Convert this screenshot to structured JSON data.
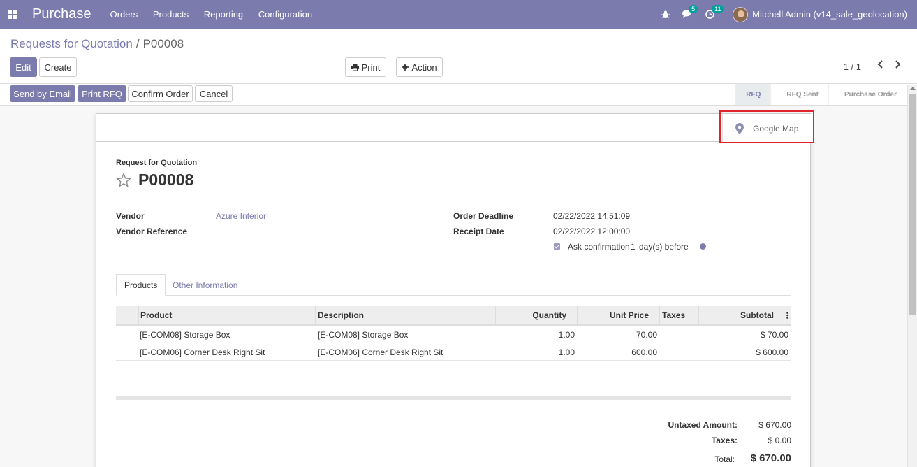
{
  "app": {
    "title": "Purchase"
  },
  "menu": [
    "Orders",
    "Products",
    "Reporting",
    "Configuration"
  ],
  "systray": {
    "messages_count": "5",
    "activities_count": "11",
    "user": "Mitchell Admin (v14_sale_geolocation)"
  },
  "breadcrumb": {
    "parent": "Requests for Quotation",
    "separator": "/",
    "current": "P00008"
  },
  "toolbar": {
    "edit": "Edit",
    "create": "Create",
    "print": "Print",
    "action": "Action"
  },
  "pager": {
    "value": "1 / 1"
  },
  "header_buttons": {
    "send_email": "Send by Email",
    "print_rfq": "Print RFQ",
    "confirm": "Confirm Order",
    "cancel": "Cancel"
  },
  "stages": [
    "RFQ",
    "RFQ Sent",
    "Purchase Order"
  ],
  "stage_active": "RFQ",
  "button_box": {
    "google_map": "Google Map"
  },
  "document": {
    "label": "Request for Quotation",
    "name": "P00008"
  },
  "fields": {
    "vendor_label": "Vendor",
    "vendor": "Azure Interior",
    "vendor_ref_label": "Vendor Reference",
    "deadline_label": "Order Deadline",
    "deadline": "02/22/2022 14:51:09",
    "receipt_label": "Receipt Date",
    "receipt": "02/22/2022 12:00:00",
    "ask_confirmation": "Ask confirmation",
    "confirm_days": "1",
    "days_before": "day(s) before"
  },
  "tabs": {
    "products": "Products",
    "other": "Other Information"
  },
  "table": {
    "headers": {
      "product": "Product",
      "description": "Description",
      "quantity": "Quantity",
      "unit_price": "Unit Price",
      "taxes": "Taxes",
      "subtotal": "Subtotal"
    },
    "rows": [
      {
        "product": "[E-COM08] Storage Box",
        "description": "[E-COM08] Storage Box",
        "quantity": "1.00",
        "unit_price": "70.00",
        "taxes": "",
        "subtotal": "$ 70.00"
      },
      {
        "product": "[E-COM06] Corner Desk Right Sit",
        "description": "[E-COM06] Corner Desk Right Sit",
        "quantity": "1.00",
        "unit_price": "600.00",
        "taxes": "",
        "subtotal": "$ 600.00"
      }
    ]
  },
  "totals": {
    "untaxed_label": "Untaxed Amount:",
    "untaxed": "$ 670.00",
    "taxes_label": "Taxes:",
    "taxes": "$ 0.00",
    "total_label": "Total:",
    "total": "$ 670.00"
  },
  "colors": {
    "brand": "#7c7bad",
    "highlight": "#e0242e"
  }
}
